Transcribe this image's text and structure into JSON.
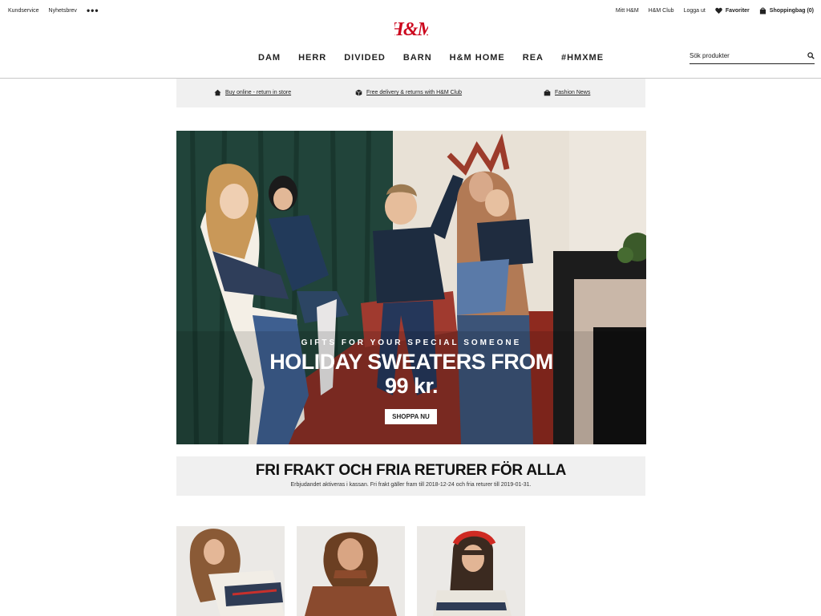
{
  "header": {
    "util_left": {
      "customer_service": "Kundservice",
      "newsletter": "Nyhetsbrev",
      "more": "•••"
    },
    "util_right": {
      "my_hm": "Mitt H&M",
      "hm_club": "H&M Club",
      "logout": "Logga ut",
      "favorites": "Favoriter",
      "bag": "Shoppingbag (0)"
    },
    "logo_alt": "H&M",
    "nav": [
      "DAM",
      "HERR",
      "DIVIDED",
      "BARN",
      "H&M HOME",
      "REA",
      "#HMXME"
    ],
    "search": {
      "placeholder": "Sök produkter"
    }
  },
  "info_strip": {
    "items": [
      {
        "icon": "home-icon",
        "label": "Buy online - return in store"
      },
      {
        "icon": "box-icon",
        "label": "Free delivery & returns with H&M Club"
      },
      {
        "icon": "bag-icon",
        "label": "Fashion News"
      }
    ]
  },
  "hero": {
    "kicker": "GIFTS FOR YOUR SPECIAL SOMEONE",
    "title_line1": "HOLIDAY SWEATERS FROM",
    "title_line2": "99 kr.",
    "cta": "SHOPPA NU"
  },
  "promo": {
    "title": "FRI FRAKT OCH FRIA RETURER FÖR ALLA",
    "subtitle": "Erbjudandet aktiveras i kassan. Fri frakt gäller fram till 2018-12-24 och fria returer till 2019-01-31."
  },
  "colors": {
    "brand_red": "#cc071e",
    "strip_bg": "#f0f0f0",
    "text": "#222222"
  },
  "products": [
    {
      "icon": "product-image-sweater-woman"
    },
    {
      "icon": "product-image-hoodie-woman"
    },
    {
      "icon": "product-image-sweater-girl"
    }
  ]
}
